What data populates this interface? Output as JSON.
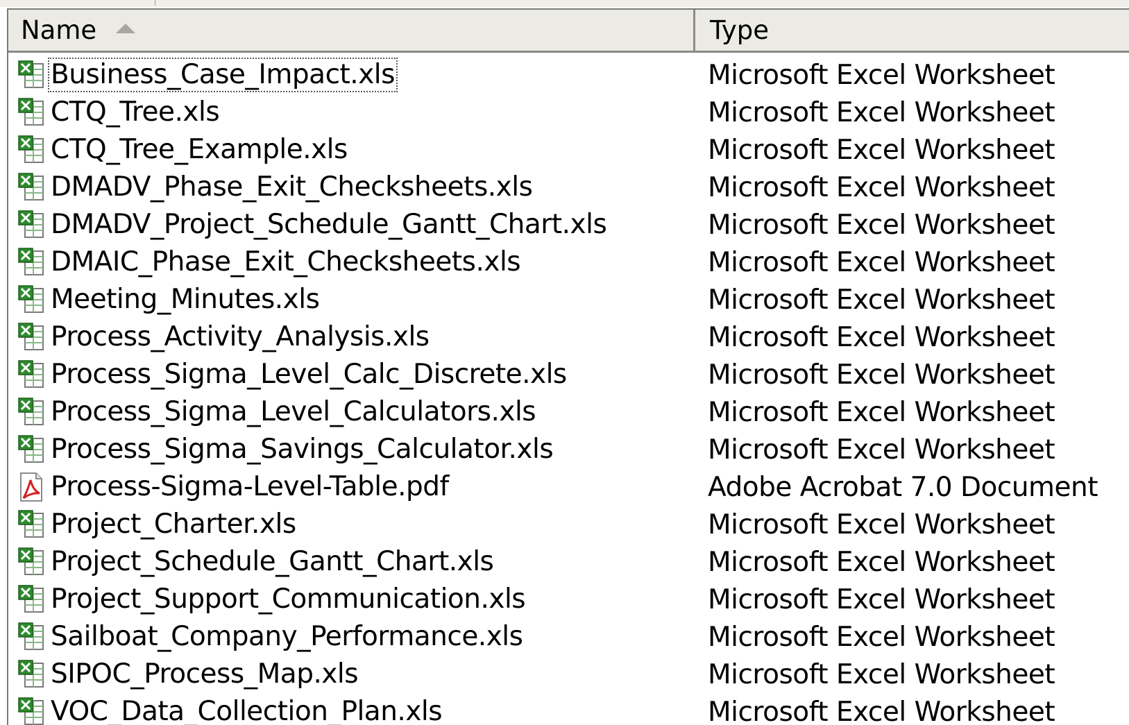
{
  "columns": {
    "name": "Name",
    "type": "Type"
  },
  "sort": {
    "column": "name",
    "direction": "ascending",
    "indicator_icon": "sort-ascending-icon"
  },
  "icons": {
    "xls": "excel-file-icon",
    "pdf": "pdf-file-icon"
  },
  "colors": {
    "excel_green": "#2e8b2e",
    "pdf_red": "#d42020",
    "header_bg": "#ebeae5"
  },
  "files": [
    {
      "name": "Business_Case_Impact.xls",
      "type": "Microsoft Excel Worksheet",
      "icon": "xls",
      "focused": true
    },
    {
      "name": "CTQ_Tree.xls",
      "type": "Microsoft Excel Worksheet",
      "icon": "xls"
    },
    {
      "name": "CTQ_Tree_Example.xls",
      "type": "Microsoft Excel Worksheet",
      "icon": "xls"
    },
    {
      "name": "DMADV_Phase_Exit_Checksheets.xls",
      "type": "Microsoft Excel Worksheet",
      "icon": "xls"
    },
    {
      "name": "DMADV_Project_Schedule_Gantt_Chart.xls",
      "type": "Microsoft Excel Worksheet",
      "icon": "xls"
    },
    {
      "name": "DMAIC_Phase_Exit_Checksheets.xls",
      "type": "Microsoft Excel Worksheet",
      "icon": "xls"
    },
    {
      "name": "Meeting_Minutes.xls",
      "type": "Microsoft Excel Worksheet",
      "icon": "xls"
    },
    {
      "name": "Process_Activity_Analysis.xls",
      "type": "Microsoft Excel Worksheet",
      "icon": "xls"
    },
    {
      "name": "Process_Sigma_Level_Calc_Discrete.xls",
      "type": "Microsoft Excel Worksheet",
      "icon": "xls"
    },
    {
      "name": "Process_Sigma_Level_Calculators.xls",
      "type": "Microsoft Excel Worksheet",
      "icon": "xls"
    },
    {
      "name": "Process_Sigma_Savings_Calculator.xls",
      "type": "Microsoft Excel Worksheet",
      "icon": "xls"
    },
    {
      "name": "Process-Sigma-Level-Table.pdf",
      "type": "Adobe Acrobat 7.0 Document",
      "icon": "pdf"
    },
    {
      "name": "Project_Charter.xls",
      "type": "Microsoft Excel Worksheet",
      "icon": "xls"
    },
    {
      "name": "Project_Schedule_Gantt_Chart.xls",
      "type": "Microsoft Excel Worksheet",
      "icon": "xls"
    },
    {
      "name": "Project_Support_Communication.xls",
      "type": "Microsoft Excel Worksheet",
      "icon": "xls"
    },
    {
      "name": "Sailboat_Company_Performance.xls",
      "type": "Microsoft Excel Worksheet",
      "icon": "xls"
    },
    {
      "name": "SIPOC_Process_Map.xls",
      "type": "Microsoft Excel Worksheet",
      "icon": "xls"
    },
    {
      "name": "VOC_Data_Collection_Plan.xls",
      "type": "Microsoft Excel Worksheet",
      "icon": "xls"
    }
  ]
}
